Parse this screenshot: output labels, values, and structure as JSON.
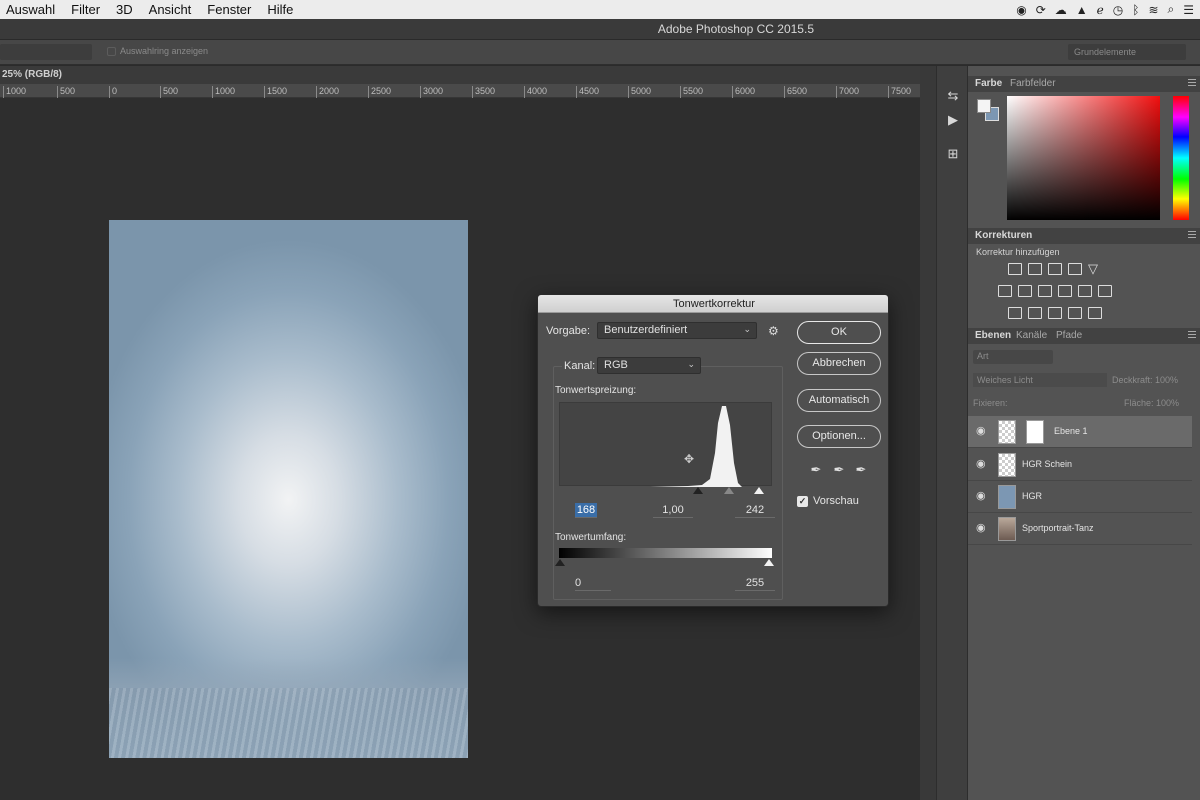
{
  "menubar": {
    "items": [
      "Auswahl",
      "Filter",
      "3D",
      "Ansicht",
      "Fenster",
      "Hilfe"
    ],
    "tray_icons": [
      "record-icon",
      "sync-icon",
      "cloud-icon",
      "drive-icon",
      "script-icon",
      "timemachine-icon",
      "bluetooth-icon",
      "wifi-icon",
      "search-icon",
      "list-icon"
    ]
  },
  "app": {
    "title": "Adobe Photoshop CC 2015.5"
  },
  "optionsbar": {
    "checkbox_label": "Auswahlring anzeigen",
    "workspace": "Grundelemente"
  },
  "document": {
    "tab_label": "25% (RGB/8)"
  },
  "ruler": {
    "labels": [
      "1000",
      "500",
      "0",
      "500",
      "1000",
      "1500",
      "2000",
      "2500",
      "3000",
      "3500",
      "4000",
      "4500",
      "5000",
      "5500",
      "6000",
      "6500",
      "7000",
      "7500"
    ]
  },
  "panels": {
    "color": {
      "tabs": [
        "Farbe",
        "Farbfelder"
      ],
      "foreground": "#f4f4f4",
      "background": "#7c97b3"
    },
    "adjustments": {
      "title": "Korrekturen",
      "subtitle": "Korrektur hinzufügen"
    },
    "layers": {
      "tabs": [
        "Ebenen",
        "Kanäle",
        "Pfade"
      ],
      "search_placeholder": "Art",
      "blend_mode": "Weiches Licht",
      "opacity_label": "Deckkraft:",
      "opacity_value": "100%",
      "lock_label": "Fixieren:",
      "fill_label": "Fläche:",
      "fill_value": "100%",
      "items": [
        {
          "name": "Ebene 1",
          "selected": true
        },
        {
          "name": "HGR Schein",
          "selected": false
        },
        {
          "name": "HGR",
          "selected": false
        },
        {
          "name": "Sportportrait-Tanz",
          "selected": false
        }
      ]
    }
  },
  "dialog": {
    "title": "Tonwertkorrektur",
    "preset_label": "Vorgabe:",
    "preset_value": "Benutzerdefiniert",
    "channel_label": "Kanal:",
    "channel_value": "RGB",
    "input_levels_label": "Tonwertspreizung:",
    "input_black": "168",
    "input_gamma": "1,00",
    "input_white": "242",
    "output_levels_label": "Tonwertumfang:",
    "output_black": "0",
    "output_white": "255",
    "buttons": {
      "ok": "OK",
      "cancel": "Abbrechen",
      "auto": "Automatisch",
      "options": "Optionen..."
    },
    "preview_label": "Vorschau",
    "preview_checked": true
  }
}
